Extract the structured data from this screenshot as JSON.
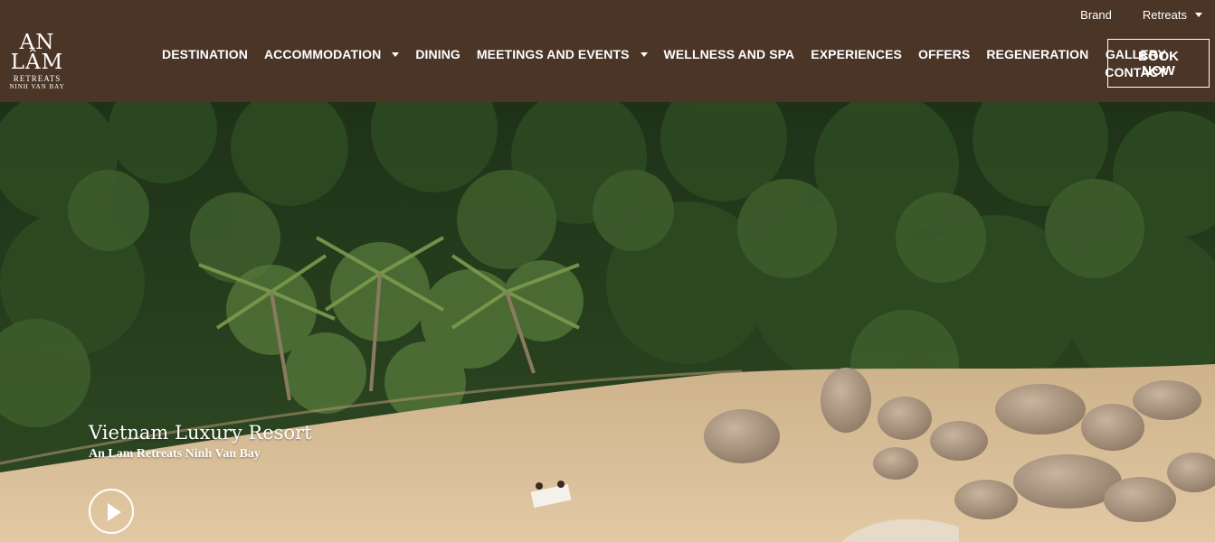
{
  "logo": {
    "line1": "AN",
    "line2": "LÂM",
    "line3": "RETREATS",
    "line4": "NINH VAN BAY"
  },
  "top_nav": {
    "brand": "Brand",
    "retreats": "Retreats"
  },
  "main_nav": {
    "destination": "DESTINATION",
    "accommodation": "ACCOMMODATION",
    "dining": "DINING",
    "meetings": "MEETINGS AND EVENTS",
    "wellness": "WELLNESS AND SPA",
    "experiences": "EXPERIENCES",
    "offers": "OFFERS",
    "regeneration": "REGENERATION",
    "gallery": "GALLERY",
    "contact": "CONTACT"
  },
  "book": {
    "line1": "BOOK",
    "line2": "NOW"
  },
  "hero": {
    "title": "Vietnam Luxury Resort",
    "subtitle": "An Lam Retreats Ninh Van Bay"
  },
  "colors": {
    "header_bg": "#4b3527",
    "text": "#ffffff",
    "sand": "#d9bf9a",
    "foliage": "#2e4a22"
  },
  "icons": {
    "play": "play-icon",
    "dropdown": "caret-down-icon"
  }
}
